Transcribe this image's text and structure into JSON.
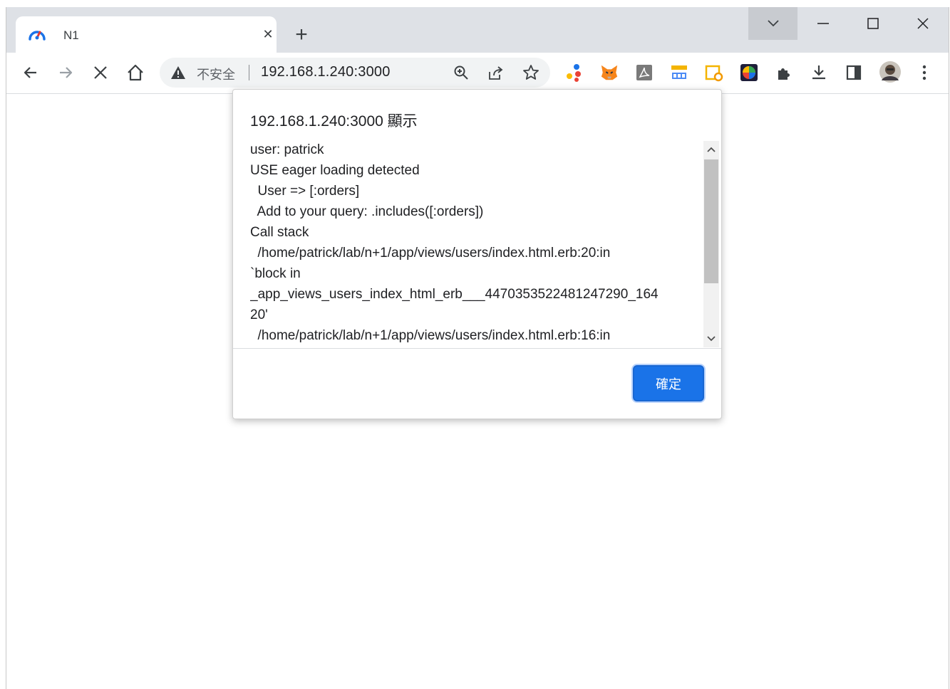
{
  "tab": {
    "title": "N1",
    "favicon": "speedometer-icon"
  },
  "window_controls": [
    "tab-search-icon",
    "minimize-icon",
    "maximize-icon",
    "close-icon"
  ],
  "toolbar": {
    "nav_icons": [
      "back-arrow-icon",
      "forward-arrow-icon",
      "stop-icon",
      "home-icon"
    ],
    "security_label": "不安全",
    "url": "192.168.1.240:3000",
    "omnibox_icons": [
      "zoom-icon",
      "share-icon",
      "bookmark-star-icon"
    ],
    "extensions": [
      "dots-extension-icon",
      "metamask-fox-icon",
      "pdf-extension-icon",
      "smartpro-extension-icon",
      "screen-capture-extension-icon",
      "rainbow-extension-icon",
      "puzzle-extensions-icon",
      "download-icon",
      "side-panel-icon",
      "profile-avatar",
      "more-menu-icon"
    ]
  },
  "dialog": {
    "title": "192.168.1.240:3000 顯示",
    "message_lines": [
      "user: patrick",
      "USE eager loading detected",
      "  User => [:orders]",
      "  Add to your query: .includes([:orders])",
      "Call stack",
      "  /home/patrick/lab/n+1/app/views/users/index.html.erb:20:in",
      "`block in",
      "_app_views_users_index_html_erb___4470353522481247290_164",
      "20'",
      "  /home/patrick/lab/n+1/app/views/users/index.html.erb:16:in"
    ],
    "ok_label": "確定"
  },
  "colors": {
    "accent": "#1a73e8",
    "tabstrip": "#dee1e6",
    "omnibox": "#f1f3f4"
  }
}
